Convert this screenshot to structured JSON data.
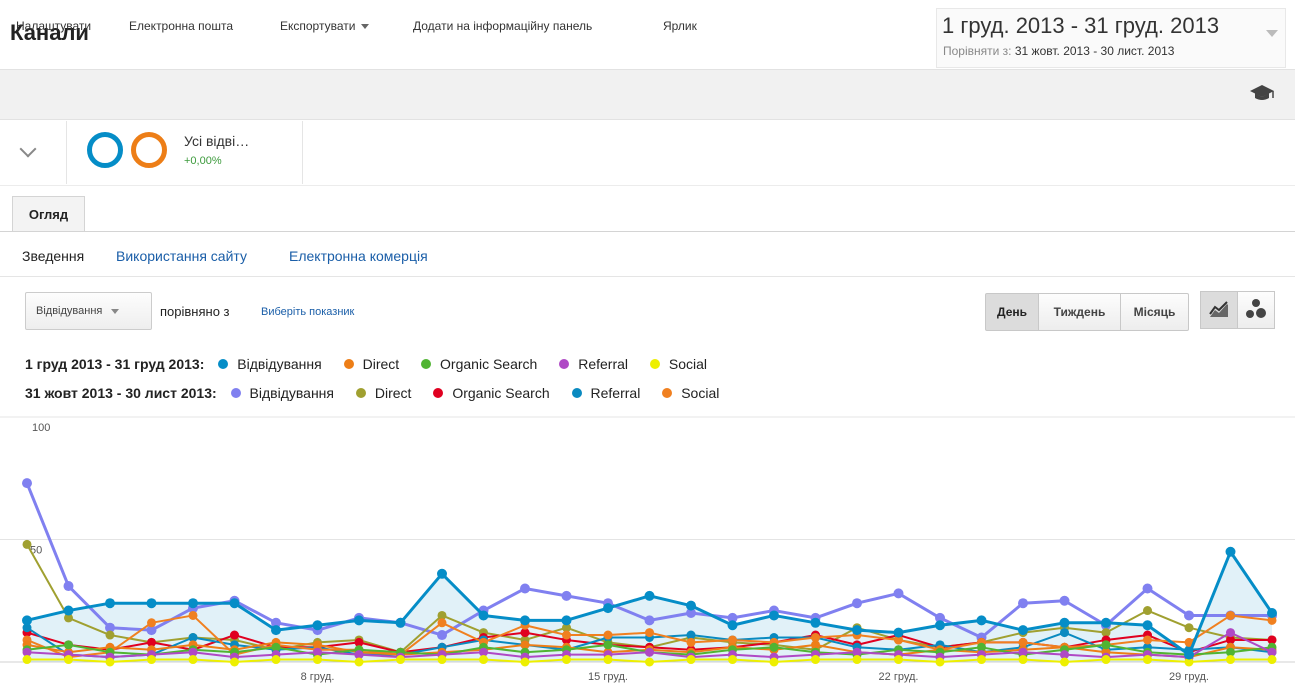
{
  "header": {
    "title": "Канали",
    "date_range": "1 груд. 2013 - 31 груд. 2013",
    "compare_prefix": "Порівняти з:",
    "compare_range": "31 жовт. 2013 - 30 лист. 2013"
  },
  "toolbar": {
    "customize": "Налаштувати",
    "email": "Електронна пошта",
    "export": "Експортувати",
    "add_dashboard": "Додати на інформаційну панель",
    "shortcut": "Ярлик",
    "icons": [
      "graduation-cap-icon"
    ]
  },
  "segment": {
    "name": "Усі відві…",
    "change": "+0,00%",
    "colors": {
      "current": "#058dc7",
      "previous": "#ed7e17"
    }
  },
  "tabs": [
    "Огляд"
  ],
  "subtabs": [
    "Зведення",
    "Використання сайту",
    "Електронна комерція"
  ],
  "controls": {
    "metric": "Відвідування",
    "compare_label": "порівняно з",
    "select_metric": "Виберіть показник",
    "period_buttons": [
      "День",
      "Тиждень",
      "Місяць"
    ],
    "active_period": "День",
    "view_icons": [
      "line-chart-icon",
      "motion-chart-icon"
    ]
  },
  "legend": {
    "row1": {
      "period": "1 груд 2013 - 31 груд 2013:",
      "items": [
        {
          "label": "Відвідування",
          "color": "#058dc7"
        },
        {
          "label": "Direct",
          "color": "#ed7e17"
        },
        {
          "label": "Organic Search",
          "color": "#50b432"
        },
        {
          "label": "Referral",
          "color": "#af49c5"
        },
        {
          "label": "Social",
          "color": "#edef00"
        }
      ]
    },
    "row2": {
      "period": "31 жовт 2013 - 30 лист 2013:",
      "items": [
        {
          "label": "Відвідування",
          "color": "#8080f0"
        },
        {
          "label": "Direct",
          "color": "#a0a030"
        },
        {
          "label": "Organic Search",
          "color": "#e00020"
        },
        {
          "label": "Referral",
          "color": "#0a8ac0"
        },
        {
          "label": "Social",
          "color": "#f08020"
        }
      ]
    }
  },
  "chart_data": {
    "type": "line",
    "y_ticks": [
      "100",
      "50"
    ],
    "ylim": [
      0,
      100
    ],
    "x_tick_labels": [
      {
        "day": 8,
        "label": "8 груд."
      },
      {
        "day": 15,
        "label": "15 груд."
      },
      {
        "day": 22,
        "label": "22 груд."
      },
      {
        "day": 29,
        "label": "29 груд."
      }
    ],
    "x": [
      1,
      2,
      3,
      4,
      5,
      6,
      7,
      8,
      9,
      10,
      11,
      12,
      13,
      14,
      15,
      16,
      17,
      18,
      19,
      20,
      21,
      22,
      23,
      24,
      25,
      26,
      27,
      28,
      29,
      30,
      31
    ],
    "series": [
      {
        "name": "Відвідування",
        "period": "1 груд 2013 - 31 груд 2013",
        "color": "#058dc7",
        "area": true,
        "values": [
          17,
          21,
          24,
          24,
          24,
          24,
          13,
          15,
          17,
          16,
          36,
          19,
          17,
          17,
          22,
          27,
          23,
          15,
          19,
          16,
          13,
          12,
          15,
          17,
          13,
          16,
          16,
          15,
          3,
          45,
          20
        ]
      },
      {
        "name": "Direct",
        "period": "1 груд 2013 - 31 груд 2013",
        "color": "#ed7e17",
        "values": [
          7,
          4,
          6,
          5,
          7,
          5,
          8,
          7,
          4,
          3,
          4,
          5,
          7,
          6,
          4,
          5,
          4,
          6,
          5,
          7,
          4,
          3,
          5,
          4,
          5,
          6,
          4,
          3,
          2,
          6,
          5
        ]
      },
      {
        "name": "Organic Search",
        "period": "1 груд 2013 - 31 груд 2013",
        "color": "#50b432",
        "values": [
          5,
          7,
          4,
          3,
          5,
          4,
          6,
          3,
          5,
          4,
          3,
          6,
          4,
          5,
          7,
          4,
          3,
          5,
          6,
          4,
          3,
          5,
          4,
          6,
          3,
          5,
          7,
          4,
          3,
          4,
          6
        ]
      },
      {
        "name": "Referral",
        "period": "1 груд 2013 - 31 груд 2013",
        "color": "#af49c5",
        "values": [
          4,
          3,
          2,
          3,
          4,
          2,
          3,
          4,
          3,
          2,
          3,
          4,
          2,
          3,
          3,
          4,
          2,
          3,
          2,
          3,
          4,
          3,
          2,
          3,
          4,
          3,
          2,
          3,
          2,
          12,
          4
        ]
      },
      {
        "name": "Social",
        "period": "1 груд 2013 - 31 груд 2013",
        "color": "#edef00",
        "values": [
          1,
          1,
          0,
          1,
          1,
          0,
          1,
          1,
          0,
          1,
          1,
          1,
          0,
          1,
          1,
          0,
          1,
          1,
          0,
          1,
          1,
          1,
          0,
          1,
          1,
          0,
          1,
          1,
          0,
          1,
          1
        ]
      },
      {
        "name": "Відвідування",
        "period": "31 жовт 2013 - 30 лист 2013",
        "color": "#8080f0",
        "values": [
          73,
          31,
          14,
          13,
          22,
          25,
          16,
          13,
          18,
          16,
          11,
          21,
          30,
          27,
          24,
          17,
          20,
          18,
          21,
          18,
          24,
          28,
          18,
          10,
          24,
          25,
          15,
          30,
          19,
          19,
          19
        ]
      },
      {
        "name": "Direct",
        "period": "31 жовт 2013 - 30 лист 2013",
        "color": "#a0a030",
        "values": [
          48,
          18,
          11,
          8,
          10,
          9,
          5,
          8,
          9,
          4,
          19,
          12,
          9,
          14,
          8,
          6,
          10,
          8,
          7,
          5,
          14,
          9,
          6,
          8,
          12,
          14,
          12,
          21,
          14,
          10,
          9
        ]
      },
      {
        "name": "Organic Search",
        "period": "31 жовт 2013 - 30 лист 2013",
        "color": "#e00020",
        "values": [
          12,
          7,
          5,
          8,
          5,
          11,
          6,
          6,
          8,
          4,
          6,
          10,
          12,
          9,
          7,
          6,
          5,
          6,
          8,
          11,
          7,
          11,
          6,
          8,
          8,
          6,
          9,
          11,
          4,
          9,
          9
        ]
      },
      {
        "name": "Referral",
        "period": "31 жовт 2013 - 30 лист 2013",
        "color": "#0a8ac0",
        "values": [
          14,
          3,
          2,
          3,
          10,
          7,
          5,
          6,
          3,
          3,
          6,
          9,
          7,
          5,
          10,
          10,
          11,
          9,
          10,
          10,
          6,
          5,
          7,
          4,
          6,
          12,
          5,
          6,
          5,
          6,
          4
        ]
      },
      {
        "name": "Social",
        "period": "31 жовт 2013 - 30 лист 2013",
        "color": "#f08020",
        "values": [
          9,
          2,
          4,
          16,
          19,
          3,
          7,
          5,
          5,
          3,
          16,
          8,
          15,
          11,
          11,
          12,
          8,
          9,
          8,
          10,
          11,
          9,
          5,
          8,
          8,
          6,
          7,
          9,
          8,
          19,
          17
        ]
      }
    ]
  }
}
